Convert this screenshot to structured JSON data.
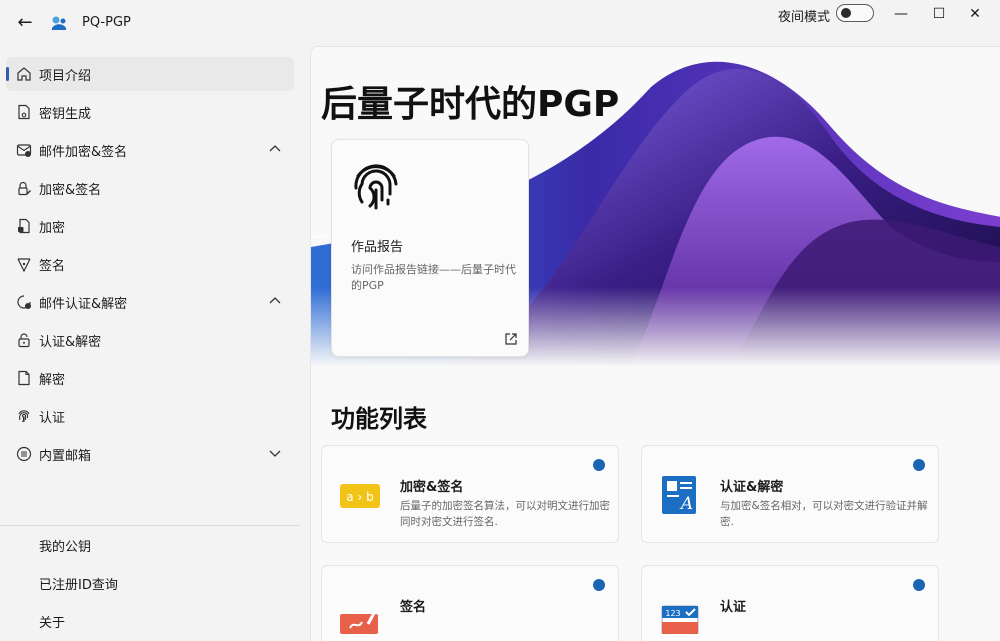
{
  "app": {
    "title": "PQ-PGP",
    "night_mode_label": "夜间模式"
  },
  "window": {
    "minimize": "—",
    "maximize": "☐",
    "close": "✕"
  },
  "sidebar": {
    "items": [
      {
        "label": "项目介绍"
      },
      {
        "label": "密钥生成"
      },
      {
        "label": "邮件加密&签名"
      },
      {
        "label": "加密&签名"
      },
      {
        "label": "加密"
      },
      {
        "label": "签名"
      },
      {
        "label": "邮件认证&解密"
      },
      {
        "label": "认证&解密"
      },
      {
        "label": "解密"
      },
      {
        "label": "认证"
      },
      {
        "label": "内置邮箱"
      }
    ],
    "footer": [
      {
        "label": "我的公钥"
      },
      {
        "label": "已注册ID查询"
      },
      {
        "label": "关于"
      }
    ]
  },
  "hero": {
    "title": "后量子时代的PGP",
    "card": {
      "title": "作品报告",
      "desc": "访问作品报告链接——后量子时代的PGP"
    }
  },
  "features": {
    "title": "功能列表",
    "cards": [
      {
        "title": "加密&签名",
        "desc": "后量子的加密签名算法，可以对明文进行加密同时对密文进行签名.",
        "icon_text": "a › b"
      },
      {
        "title": "认证&解密",
        "desc": "与加密&签名相对，可以对密文进行验证并解密."
      },
      {
        "title": "签名",
        "desc": ""
      },
      {
        "title": "认证",
        "desc": "",
        "icon_text": "123"
      }
    ]
  },
  "colors": {
    "accent": "#2e5fb3",
    "dot": "#1a64b4"
  }
}
